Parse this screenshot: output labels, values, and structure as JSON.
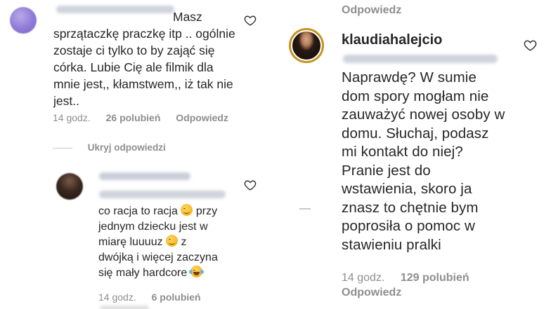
{
  "left_panel": {
    "comment": {
      "username_blurred": "",
      "lines": [
        "Masz",
        "sprzątaczkę praczkę itp .. ogólnie",
        "zostaje ci tylko to by zająć się",
        "córka. Lubie Cię ale filmik dla",
        "mnie jest,, kłamstwem,, iż tak nie",
        "jest.."
      ],
      "time": "14 godz.",
      "likes": "26 polubień",
      "reply_label": "Odpowiedz"
    },
    "hide_replies_label": "Ukryj odpowiedzi",
    "reply": {
      "lines": [
        "co racja to racja",
        "przy",
        "jednym dziecku jest w",
        "miarę luuuuz",
        "z",
        "dwójką i więcej zaczyna",
        "się mały hardcore"
      ],
      "time": "14 godz.",
      "likes": "6 polubień"
    }
  },
  "right_panel": {
    "top_reply_label": "Odpowiedz",
    "comment": {
      "username": "klaudiahalejcio",
      "lines": [
        "Naprawdę? W sumie",
        "dom spory mogłam nie",
        "zauważyć nowej osoby w",
        "domu. Słuchaj, podasz",
        "mi kontakt do niej?",
        "Pranie jest do",
        "wstawienia, skoro ja",
        "znasz to chętnie bym",
        "poprosiła o pomoc w",
        "stawieniu pralki"
      ],
      "time": "14 godz.",
      "likes": "129 polubień",
      "reply_label": "Odpowiedz"
    }
  },
  "icons": {
    "heart": "heart-icon"
  },
  "colors": {
    "text": "#262626",
    "meta": "#8e8e8e"
  }
}
